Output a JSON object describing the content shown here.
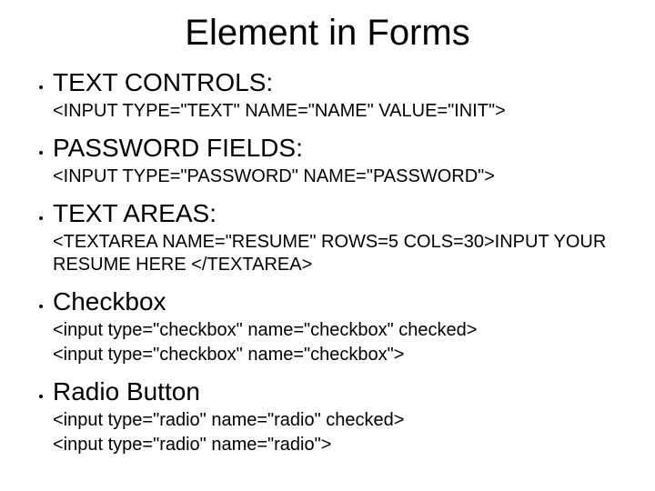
{
  "title": "Element in Forms",
  "items": [
    {
      "heading": "TEXT CONTROLS:",
      "lines": [
        "<INPUT TYPE=\"TEXT\" NAME=\"NAME\" VALUE=\"INIT\">"
      ]
    },
    {
      "heading": "PASSWORD FIELDS:",
      "lines": [
        "<INPUT TYPE=\"PASSWORD\" NAME=\"PASSWORD\">"
      ]
    },
    {
      "heading": "TEXT AREAS:",
      "lines": [
        "<TEXTAREA NAME=\"RESUME\" ROWS=5 COLS=30>INPUT YOUR RESUME HERE </TEXTAREA>"
      ]
    },
    {
      "heading": "Checkbox",
      "lines": [
        "<input type=\"checkbox\" name=\"checkbox\" checked>",
        "<input type=\"checkbox\" name=\"checkbox\">"
      ]
    },
    {
      "heading": "Radio Button",
      "lines": [
        "<input type=\"radio\" name=\"radio\" checked>",
        "<input type=\"radio\" name=\"radio\">"
      ]
    }
  ]
}
